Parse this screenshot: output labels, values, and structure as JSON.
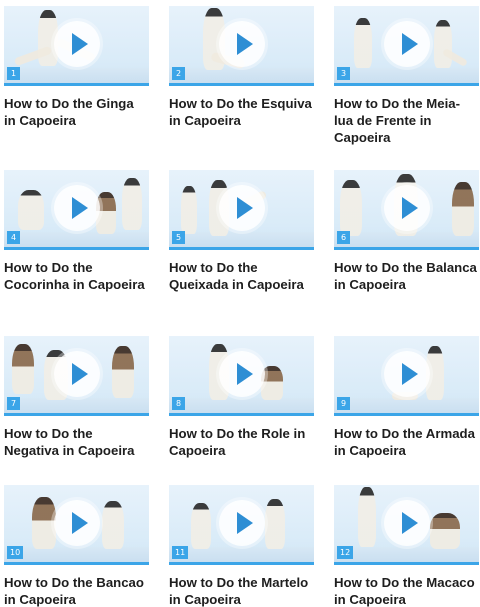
{
  "videos": [
    {
      "number": "1",
      "title": "How to Do the Ginga in Capoeira"
    },
    {
      "number": "2",
      "title": "How to Do the Esquiva in Capoeira"
    },
    {
      "number": "3",
      "title": "How to Do the Meia-lua de Frente in Capoeira"
    },
    {
      "number": "4",
      "title": "How to Do the Cocorinha in Capoeira"
    },
    {
      "number": "5",
      "title": "How to Do the Queixada in Capoeira"
    },
    {
      "number": "6",
      "title": "How to Do the Balanca in Capoeira"
    },
    {
      "number": "7",
      "title": "How to Do the Negativa in Capoeira"
    },
    {
      "number": "8",
      "title": "How to Do the Role in Capoeira"
    },
    {
      "number": "9",
      "title": "How to Do the Armada in Capoeira"
    },
    {
      "number": "10",
      "title": "How to Do the Bancao in Capoeira"
    },
    {
      "number": "11",
      "title": "How to Do the Martelo in Capoeira"
    },
    {
      "number": "12",
      "title": "How to Do the Macaco in Capoeira"
    }
  ],
  "icons": {
    "play": "play-icon"
  },
  "colors": {
    "accent": "#3ba5e8",
    "play_arrow": "#2e8ed4"
  }
}
